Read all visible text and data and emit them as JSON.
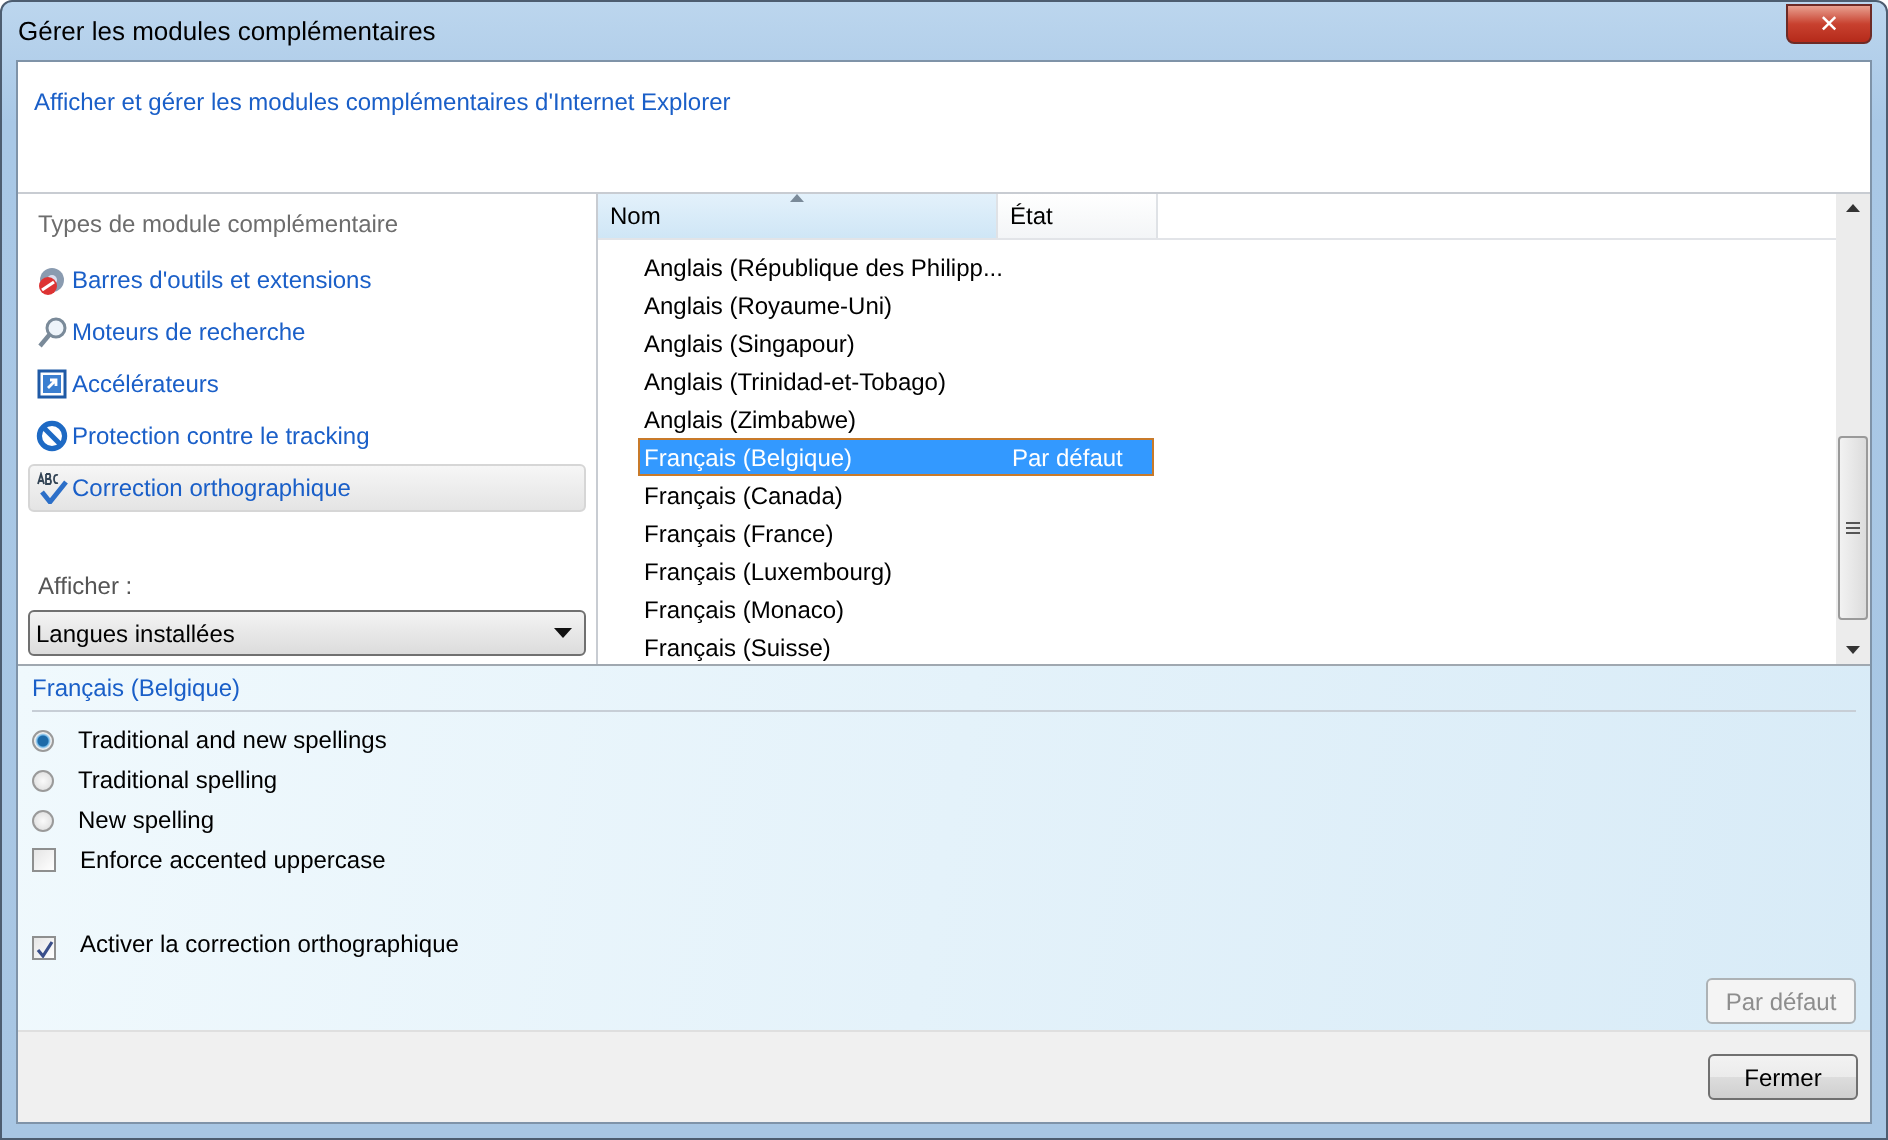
{
  "window": {
    "title": "Gérer les modules complémentaires",
    "close": "✕"
  },
  "header": {
    "text": "Afficher et gérer les modules complémentaires d'Internet Explorer"
  },
  "sidebar": {
    "heading": "Types de module complémentaire",
    "items": [
      {
        "kind": "gear",
        "label": "Barres d'outils et extensions",
        "selected": false
      },
      {
        "kind": "search",
        "label": "Moteurs de recherche",
        "selected": false
      },
      {
        "kind": "accelerator",
        "label": "Accélérateurs",
        "selected": false
      },
      {
        "kind": "block",
        "label": "Protection contre le tracking",
        "selected": false
      },
      {
        "kind": "spell",
        "label": "Correction orthographique",
        "selected": true
      }
    ],
    "show_label": "Afficher :",
    "show_value": "Langues installées"
  },
  "table": {
    "columns": [
      "Nom",
      "État"
    ],
    "rows": [
      {
        "name": "Anglais (République des Philipp...",
        "selected": false
      },
      {
        "name": "Anglais (Royaume-Uni)",
        "selected": false
      },
      {
        "name": "Anglais (Singapour)",
        "selected": false
      },
      {
        "name": "Anglais (Trinidad-et-Tobago)",
        "selected": false
      },
      {
        "name": "Anglais (Zimbabwe)",
        "selected": false
      },
      {
        "name": "Français (Belgique)",
        "state": "Par défaut",
        "selected": true
      },
      {
        "name": "Français (Canada)",
        "selected": false
      },
      {
        "name": "Français (France)",
        "selected": false
      },
      {
        "name": "Français (Luxembourg)",
        "selected": false
      },
      {
        "name": "Français (Monaco)",
        "selected": false
      },
      {
        "name": "Français (Suisse)",
        "selected": false
      }
    ]
  },
  "details": {
    "title": "Français (Belgique)",
    "options": [
      {
        "kind": "radio",
        "label": "Traditional and new spellings",
        "selected": true
      },
      {
        "kind": "radio",
        "label": "Traditional spelling",
        "selected": false
      },
      {
        "kind": "radio",
        "label": "New spelling",
        "selected": false
      },
      {
        "kind": "checkbox",
        "label": "Enforce accented uppercase",
        "checked": false
      },
      {
        "kind": "gap"
      },
      {
        "kind": "checkbox",
        "label": "Activer la correction orthographique",
        "checked": true
      }
    ],
    "default_button": {
      "label": "Par défaut",
      "disabled": true
    }
  },
  "footer": {
    "close_button": {
      "label": "Fermer",
      "disabled": false
    }
  }
}
